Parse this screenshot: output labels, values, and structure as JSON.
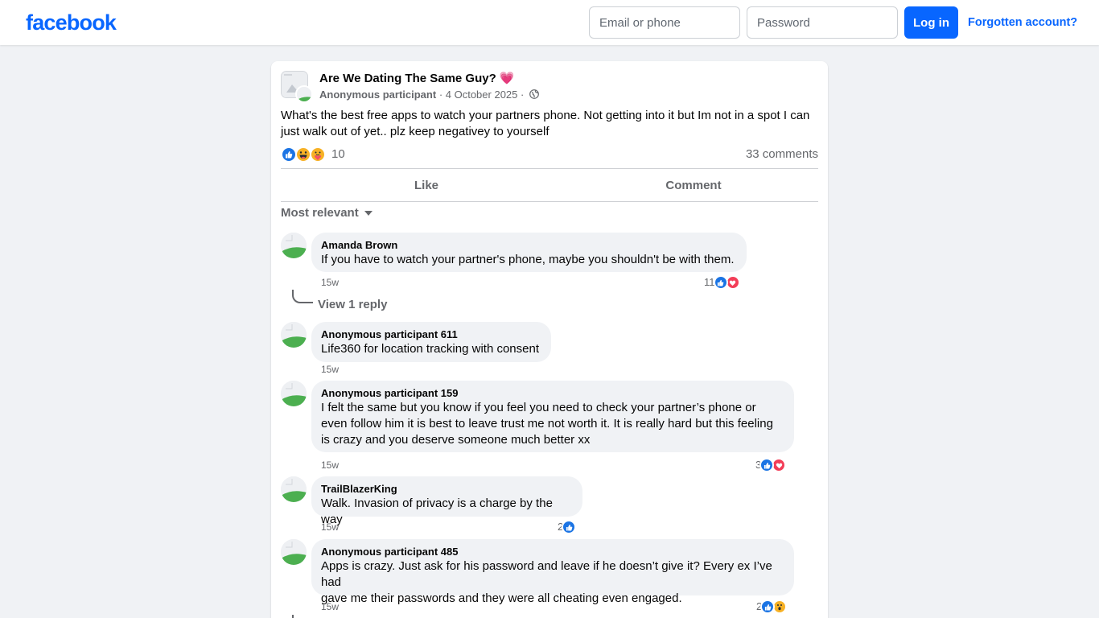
{
  "header": {
    "logo": "facebook",
    "email_placeholder": "Email or phone",
    "password_placeholder": "Password",
    "login_label": "Log in",
    "forgot_label": "Forgotten account?"
  },
  "post": {
    "group_name": "Are We Dating The Same Guy?",
    "group_emoji": "💗",
    "author": "Anonymous participant",
    "date": "4 October 2025",
    "body": "What's the best free apps to watch your partners phone. Not getting into it but Im not in a spot I can just walk out of yet.. plz keep negativey to yourself",
    "reaction_count": "10",
    "comment_count": "33 comments",
    "reaction_icons": [
      "like-icon",
      "haha-icon",
      "care-icon"
    ]
  },
  "actions": {
    "like_label": "Like",
    "comment_label": "Comment"
  },
  "sort": {
    "label": "Most relevant"
  },
  "comments": [
    {
      "name": "Amanda Brown",
      "lines": [
        "If you have to watch your partner's phone, maybe you shouldn't be with them."
      ],
      "time": "15w",
      "reactions": "11",
      "reaction_icons": [
        "like-icon",
        "love-icon"
      ]
    },
    {
      "name": "Anonymous participant 611",
      "lines": [
        "Life360 for location tracking with consent"
      ],
      "time": "15w",
      "reactions": "",
      "reaction_icons": []
    },
    {
      "name": "Anonymous participant 159",
      "lines": [
        "I felt the same but you know if you feel you need to check your partner’s phone or",
        "even follow him it is best to leave trust me not worth it. It is really hard but this feeling",
        "is crazy and you deserve someone much better xx"
      ],
      "time": "15w",
      "reactions": "3",
      "reaction_icons": [
        "like-icon",
        "love-icon"
      ]
    },
    {
      "name": "TrailBlazerKing",
      "lines": [
        "Walk. Invasion of privacy is a charge by the way"
      ],
      "time": "15w",
      "reactions": "2",
      "reaction_icons": [
        "like-icon"
      ]
    },
    {
      "name": "Anonymous participant 485",
      "lines": [
        "Apps is crazy. Just ask for his password and leave if he doesn’t give it? Every ex I’ve had",
        "gave me their passwords and they were all cheating even engaged."
      ],
      "time": "15w",
      "reactions": "2",
      "reaction_icons": [
        "like-icon",
        "wow-icon"
      ]
    }
  ],
  "replies": {
    "view_label": "View 1 reply"
  },
  "colors": {
    "brand": "#0866ff",
    "background": "#f0f2f5",
    "like": "#1b74e4",
    "love": "#f33e58",
    "haha": "#f7b125"
  }
}
